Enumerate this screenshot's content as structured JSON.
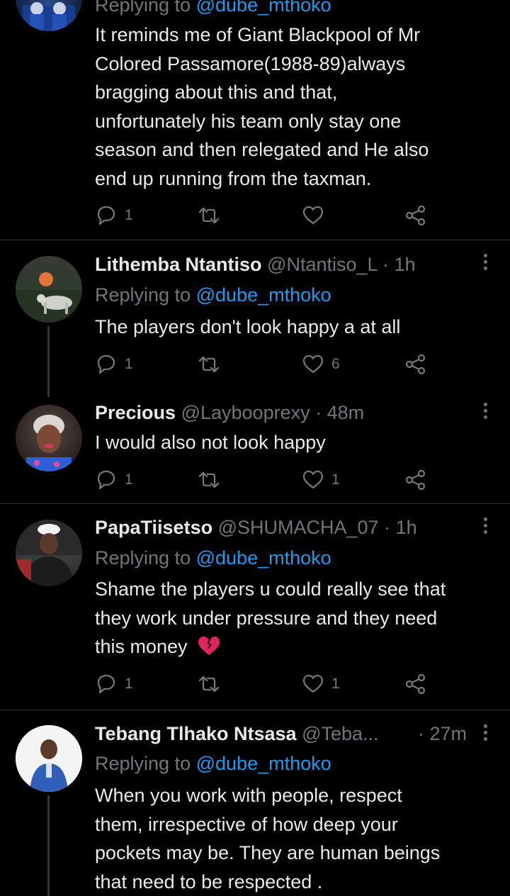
{
  "tweets": [
    {
      "replying_label": "Replying to",
      "mention": "@dube_mthoko",
      "text_lines": [
        "It reminds me of Giant Blackpool of Mr",
        "Colored Passamore(1988-89)always",
        "bragging about this and that,",
        "unfortunately his team only stay one",
        "season and then relegated and He also",
        "end up running from the taxman."
      ],
      "reply_count": "1",
      "retweet_count": "",
      "like_count": ""
    },
    {
      "name": "Lithemba Ntantiso",
      "handle": "@Ntantiso_L",
      "time": "· 1h",
      "replying_label": "Replying to",
      "mention": "@dube_mthoko",
      "text_lines": [
        "The players don't look happy a at all"
      ],
      "reply_count": "1",
      "retweet_count": "",
      "like_count": "6"
    },
    {
      "name": "Precious",
      "handle": "@Laybooprexy",
      "time": "· 48m",
      "text_lines": [
        "I would also not look happy"
      ],
      "reply_count": "1",
      "retweet_count": "",
      "like_count": "1"
    },
    {
      "name": "PapaTiisetso",
      "handle": "@SHUMACHA_07",
      "time": "· 1h",
      "replying_label": "Replying to",
      "mention": "@dube_mthoko",
      "text_lines": [
        "Shame the players u could really see that",
        "they work under pressure and they need",
        "this money"
      ],
      "emoji": "broken-heart",
      "reply_count": "1",
      "retweet_count": "",
      "like_count": "1"
    },
    {
      "name": "Tebang Tlhako Ntsasa",
      "handle": "@Teba...",
      "time": "· 27m",
      "replying_label": "Replying to",
      "mention": "@dube_mthoko",
      "text_lines": [
        "When you work with people, respect",
        "them, irrespective of how deep your",
        "pockets may be. They are human beings",
        "that need to be respected ."
      ]
    }
  ],
  "colors": {
    "background": "#000000",
    "text": "#e7e9ea",
    "muted": "#71767b",
    "accent": "#1d9bf0",
    "divider": "#2f3336"
  }
}
